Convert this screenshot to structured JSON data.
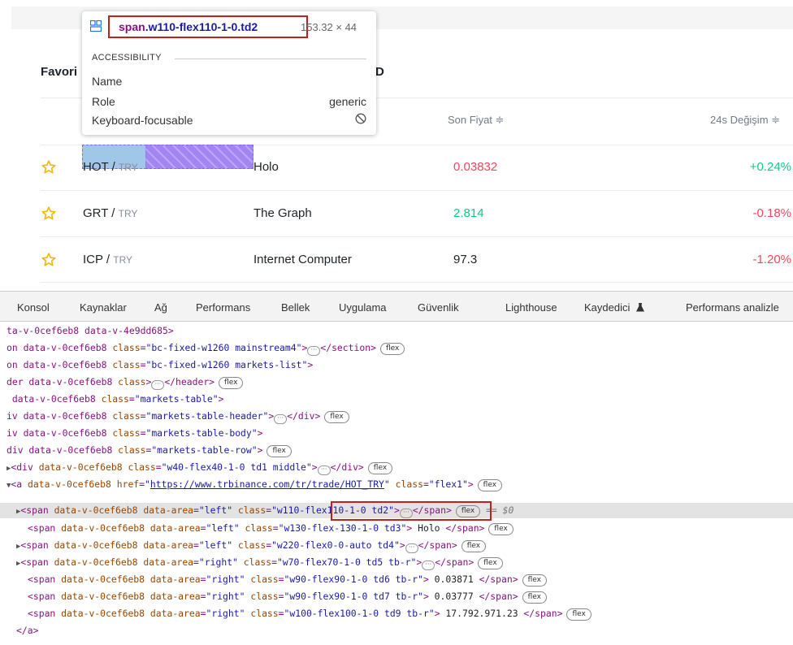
{
  "page": {
    "favorites_title": "Favori",
    "header_tail": "D",
    "columns": {
      "last_price": "Son Fiyat ≑",
      "change_24h": "24s Değişim ≑"
    },
    "rows": [
      {
        "base": "HOT",
        "quote": "TRY",
        "name": "Holo",
        "price": "0.03832",
        "price_color": "#f6465d",
        "change": "+0.24%",
        "change_color": "#0ecb81"
      },
      {
        "base": "GRT",
        "quote": "TRY",
        "name": "The Graph",
        "price": "2.814",
        "price_color": "#0ecb81",
        "change": "-0.18%",
        "change_color": "#f6465d"
      },
      {
        "base": "ICP",
        "quote": "TRY",
        "name": "Internet Computer",
        "price": "97.3",
        "price_color": "#1e2329",
        "change": "-1.20%",
        "change_color": "#f6465d"
      }
    ],
    "pair_separator": " / "
  },
  "tooltip": {
    "selector_tag": "span",
    "selector_class": ".w110-flex110-1-0.td2",
    "size": "153.32 × 44",
    "section": "ACCESSIBILITY",
    "name_label": "Name",
    "role_label": "Role",
    "role_value": "generic",
    "focus_label": "Keyboard-focusable",
    "icons": {
      "element": "grid-icon",
      "not_focusable": "block-icon"
    }
  },
  "devtools": {
    "tabs": [
      "Konsol",
      "Kaynaklar",
      "Ağ",
      "Performans",
      "Bellek",
      "Uygulama",
      "Güvenlik",
      "Lighthouse",
      "Kaydedici",
      "Performans analizle"
    ],
    "recorder_icon": "flask-icon",
    "badge": "flex",
    "selected_marker": "== $0",
    "lines": {
      "l0_text": "ta-v-0cef6eb8 data-v-4e9dd685>",
      "l1_pre": "on data-v-0cef6eb8 ",
      "l1_an": "class",
      "l1_av": "\"bc-fixed-w1260 mainstream4\"",
      "l1_close": "</section>",
      "l2_pre": "on data-v-0cef6eb8 ",
      "l2_an": "class",
      "l2_av": "\"bc-fixed-w1260 markets-list\"",
      "l3_pre": "der data-v-0cef6eb8 ",
      "l3_an": "class",
      "l3_close": "</header>",
      "l4_pre": " data-v-0cef6eb8 ",
      "l4_an": "class",
      "l4_av": "\"markets-table\"",
      "l5_pre": "iv data-v-0cef6eb8 ",
      "l5_an": "class",
      "l5_av": "\"markets-table-header\"",
      "l5_close": "</div>",
      "l6_pre": "iv data-v-0cef6eb8 ",
      "l6_an": "class",
      "l6_av": "\"markets-table-body\"",
      "l7_pre": "div data-v-0cef6eb8 ",
      "l7_an": "class",
      "l7_av": "\"markets-table-row\"",
      "l8_tag": "<div",
      "l8_an1": "data-v-0cef6eb8",
      "l8_an2": "class",
      "l8_av": "\"w40-flex40-1-0 td1 middle\"",
      "l8_close": "</div>",
      "l9_tag": "<a",
      "l9_an1": "data-v-0cef6eb8",
      "l9_an2": "href",
      "l9_url": "https://www.trbinance.com/tr/trade/HOT_TRY",
      "l9_an3": "class",
      "l9_av": "\"flex1\"",
      "l10_tag": "<span",
      "l10_an1": "data-v-0cef6eb8",
      "l10_an2": "data-area",
      "l10_av1": "\"left\"",
      "l10_an3": "class",
      "l10_av2": "\"w110-flex110-1-0 td2\"",
      "l10_close": "</span>",
      "l11_tag": "<span",
      "l11_an1": "data-v-0cef6eb8",
      "l11_an2": "data-area",
      "l11_av1": "\"left\"",
      "l11_an3": "class",
      "l11_av2": "\"w130-flex-130-1-0 td3\"",
      "l11_text": " Holo ",
      "l11_close": "</span>",
      "l12_tag": "<span",
      "l12_an1": "data-v-0cef6eb8",
      "l12_an2": "data-area",
      "l12_av1": "\"left\"",
      "l12_an3": "class",
      "l12_av2": "\"w220-flex0-0-auto td4\"",
      "l12_close": "</span>",
      "l13_tag": "<span",
      "l13_an1": "data-v-0cef6eb8",
      "l13_an2": "data-area",
      "l13_av1": "\"right\"",
      "l13_an3": "class",
      "l13_av2": "\"w70-flex70-1-0 td5 tb-r\"",
      "l13_close": "</span>",
      "l14_tag": "<span",
      "l14_an1": "data-v-0cef6eb8",
      "l14_an2": "data-area",
      "l14_av1": "\"right\"",
      "l14_an3": "class",
      "l14_av2": "\"w90-flex90-1-0 td6 tb-r\"",
      "l14_text": " 0.03871 ",
      "l14_close": "</span>",
      "l15_tag": "<span",
      "l15_an1": "data-v-0cef6eb8",
      "l15_an2": "data-area",
      "l15_av1": "\"right\"",
      "l15_an3": "class",
      "l15_av2": "\"w90-flex90-1-0 td7 tb-r\"",
      "l15_text": " 0.03777 ",
      "l15_close": "</span>",
      "l16_tag": "<span",
      "l16_an1": "data-v-0cef6eb8",
      "l16_an2": "data-area",
      "l16_av1": "\"right\"",
      "l16_an3": "class",
      "l16_av2": "\"w100-flex100-1-0 td9 tb-r\"",
      "l16_text": " 17.792.971.23 ",
      "l16_close": "</span>",
      "l17_text": "</a>"
    }
  }
}
